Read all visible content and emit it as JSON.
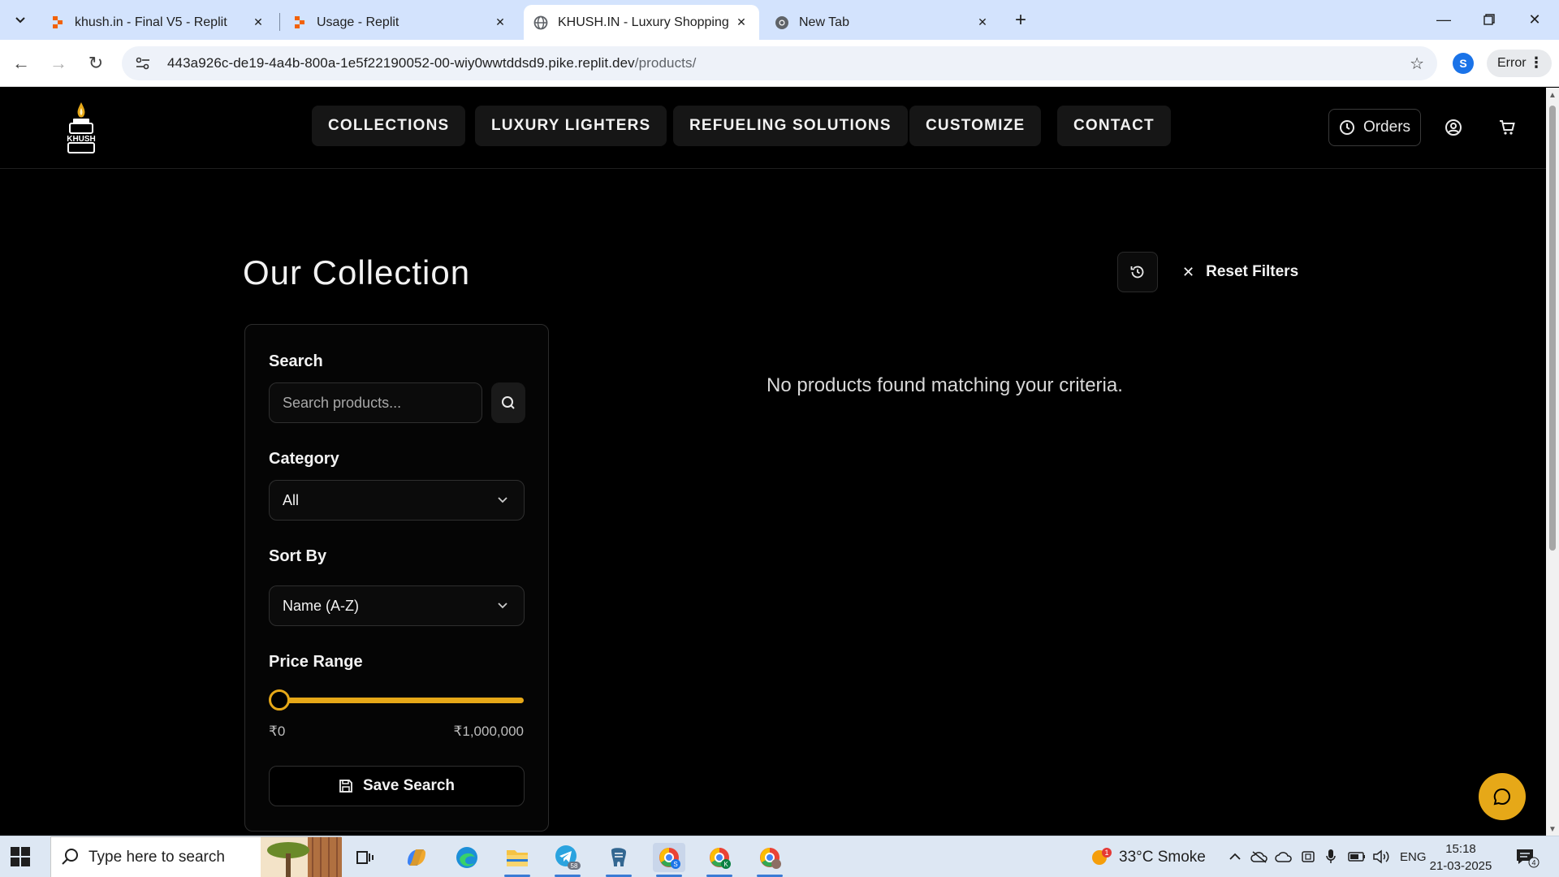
{
  "browser": {
    "tabs": [
      {
        "title": "khush.in - Final V5 - Replit",
        "favicon": "replit-icon",
        "active": false
      },
      {
        "title": "Usage - Replit",
        "favicon": "replit-icon",
        "active": false
      },
      {
        "title": "KHUSH.IN - Luxury Shopping E",
        "favicon": "globe-icon",
        "active": true
      },
      {
        "title": "New Tab",
        "favicon": "chrome-icon",
        "active": false
      }
    ],
    "url_host": "443a926c-de19-4a4b-800a-1e5f22190052-00-wiy0wwtddsd9.pike.replit.dev",
    "url_path": "/products/",
    "profile_initial": "S",
    "error_label": "Error"
  },
  "site": {
    "logo_text": "KHUSH",
    "nav": [
      "COLLECTIONS",
      "LUXURY LIGHTERS",
      "REFUELING SOLUTIONS",
      "CUSTOMIZE",
      "CONTACT"
    ],
    "orders_label": "Orders",
    "accent_color": "#e6a818"
  },
  "main": {
    "title": "Our Collection",
    "reset_label": "Reset Filters",
    "empty_message": "No products found matching your criteria."
  },
  "filters": {
    "search_label": "Search",
    "search_placeholder": "Search products...",
    "category_label": "Category",
    "category_value": "All",
    "sort_label": "Sort By",
    "sort_value": "Name (A-Z)",
    "price_label": "Price Range",
    "price_min": "₹0",
    "price_max": "₹1,000,000",
    "save_label": "Save Search"
  },
  "taskbar": {
    "search_placeholder": "Type here to search",
    "weather": "33°C  Smoke",
    "weather_badge": "1",
    "language": "ENG",
    "time": "15:18",
    "date": "21-03-2025",
    "notification_count": "4",
    "telegram_badge": "58"
  }
}
